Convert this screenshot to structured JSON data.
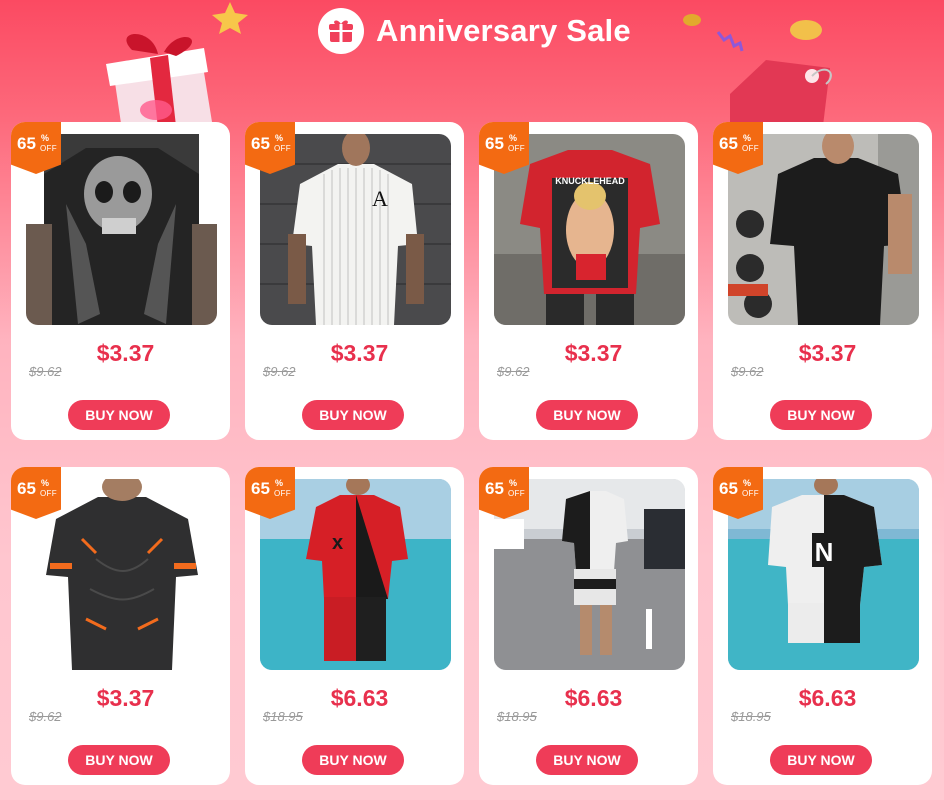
{
  "header": {
    "title": "Anniversary Sale",
    "icon": "gift-icon"
  },
  "colors": {
    "background_top": "#fb4a62",
    "background_bottom": "#ffcad2",
    "price": "#e8304d",
    "button": "#ef3c58",
    "badge": "#f36a12"
  },
  "products": [
    {
      "discount": "65",
      "percent": "%",
      "off": "OFF",
      "price": "$3.37",
      "original_price": "$9.62",
      "button": "BUY NOW",
      "image": "skull-print-tshirt-photo"
    },
    {
      "discount": "65",
      "percent": "%",
      "off": "OFF",
      "price": "$3.37",
      "original_price": "$9.62",
      "button": "BUY NOW",
      "image": "pinstripe-ace-tshirt-photo"
    },
    {
      "discount": "65",
      "percent": "%",
      "off": "OFF",
      "price": "$3.37",
      "original_price": "$9.62",
      "button": "BUY NOW",
      "image": "red-graphic-tshirt-photo"
    },
    {
      "discount": "65",
      "percent": "%",
      "off": "OFF",
      "price": "$3.37",
      "original_price": "$9.62",
      "button": "BUY NOW",
      "image": "black-fitted-tshirt-photo"
    },
    {
      "discount": "65",
      "percent": "%",
      "off": "OFF",
      "price": "$3.37",
      "original_price": "$9.62",
      "button": "BUY NOW",
      "image": "black-orange-sport-tshirt-photo"
    },
    {
      "discount": "65",
      "percent": "%",
      "off": "OFF",
      "price": "$6.63",
      "original_price": "$18.95",
      "button": "BUY NOW",
      "image": "red-black-tracksuit-photo"
    },
    {
      "discount": "65",
      "percent": "%",
      "off": "OFF",
      "price": "$6.63",
      "original_price": "$18.95",
      "button": "BUY NOW",
      "image": "black-white-tracksuit-photo"
    },
    {
      "discount": "65",
      "percent": "%",
      "off": "OFF",
      "price": "$6.63",
      "original_price": "$18.95",
      "button": "BUY NOW",
      "image": "believe-in-yourself-set-photo"
    }
  ]
}
